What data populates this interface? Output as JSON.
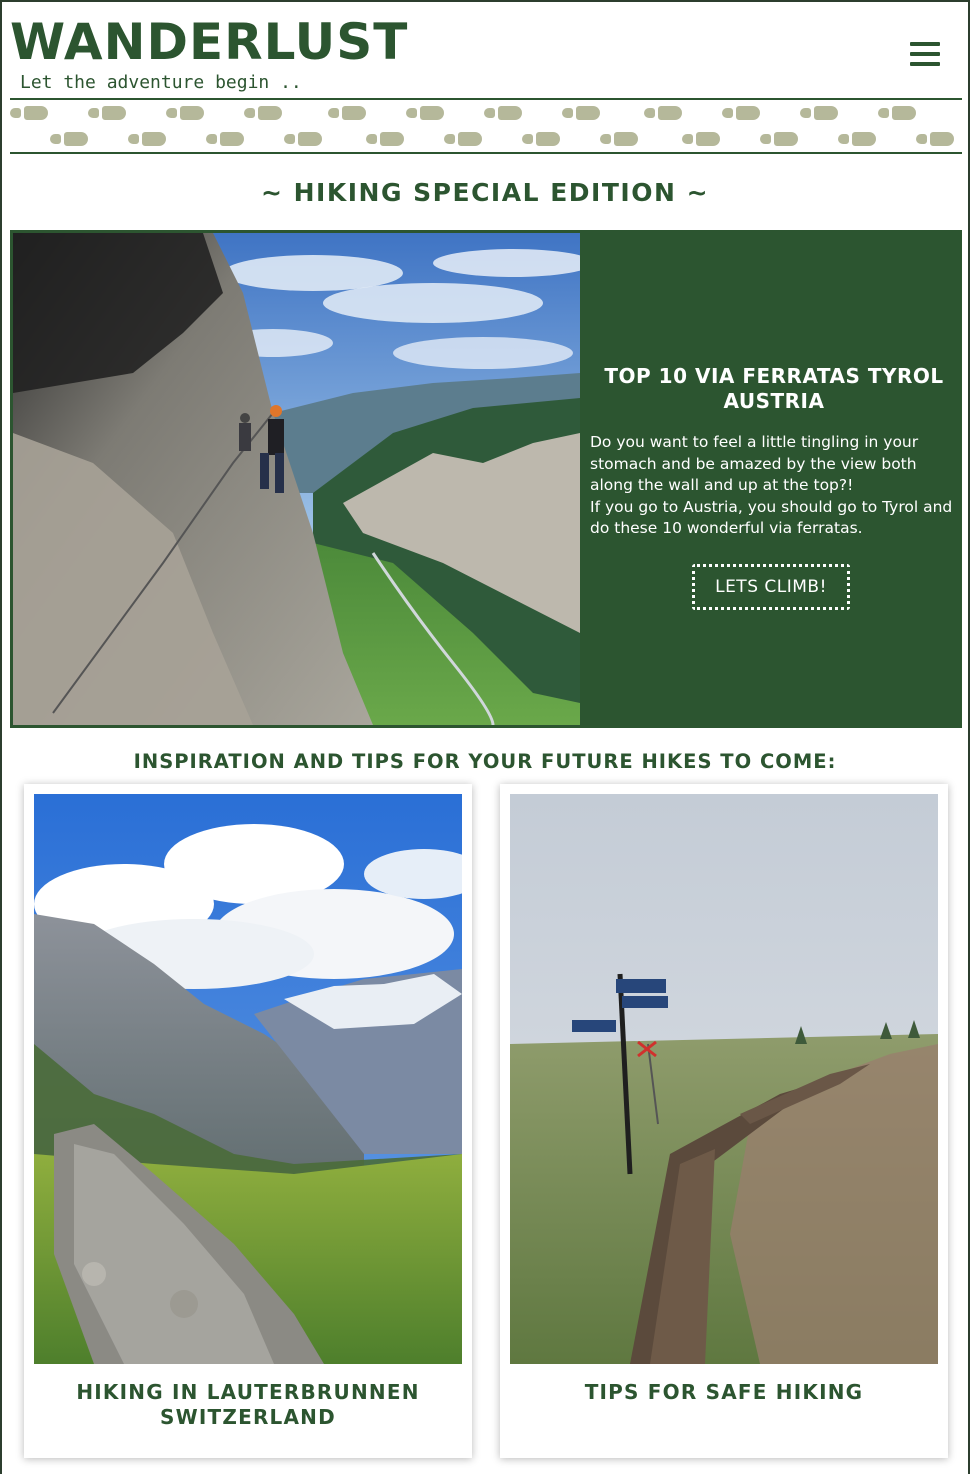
{
  "header": {
    "logo": "WANDERLUST",
    "tagline": "Let the adventure begin ..",
    "menu_icon": "hamburger-menu-icon"
  },
  "decoration": {
    "footprint_icon": "footprint-icon",
    "footprint_color": "#b5b89a"
  },
  "colors": {
    "brand_green": "#2c5530",
    "white": "#ffffff"
  },
  "edition": {
    "title": "~ HIKING SPECIAL EDITION ~"
  },
  "feature": {
    "title": "TOP 10 VIA FERRATAS TYROL AUSTRIA",
    "paragraph_1": "Do you want to feel a little tingling in your stomach and be amazed by the view both along the wall and up at the top?!",
    "paragraph_2": "If you go to Austria, you should go to Tyrol and do these 10 wonderful via ferratas.",
    "cta_label": "LETS CLIMB!"
  },
  "inspiration": {
    "title": "INSPIRATION AND TIPS FOR YOUR FUTURE HIKES TO COME:",
    "cards": [
      {
        "title": "HIKING IN LAUTERBRUNNEN SWITZERLAND"
      },
      {
        "title": "TIPS FOR SAFE HIKING"
      }
    ]
  }
}
